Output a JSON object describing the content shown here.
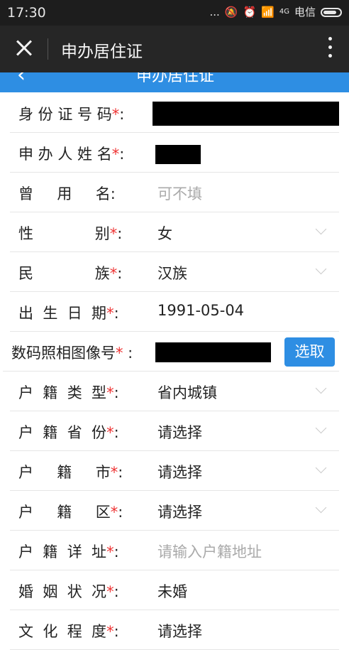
{
  "status_bar": {
    "time": "17:30",
    "dots": "...",
    "network": "4G",
    "carrier": "电信"
  },
  "app_bar": {
    "title": "申办居住证"
  },
  "page_header": {
    "title": "申办居住证"
  },
  "form": {
    "rows": [
      {
        "label": "身 份 证 号 码",
        "required": "*",
        "colon": ":",
        "value": ""
      },
      {
        "label": "申 办 人 姓 名",
        "required": "*",
        "colon": ":",
        "value": ""
      },
      {
        "label": "曾     用     名",
        "required": "",
        "colon": ":",
        "value": "",
        "placeholder": "可不填"
      },
      {
        "label": "性             别",
        "required": "*",
        "colon": ":",
        "value": "女"
      },
      {
        "label": "民             族",
        "required": "*",
        "colon": ":",
        "value": "汉族"
      },
      {
        "label": "出  生  日  期",
        "required": "*",
        "colon": ":",
        "value": "1991-05-04"
      },
      {
        "label": "数码照相图像号",
        "required": "*",
        "colon": " :",
        "value": "",
        "button": "选取"
      },
      {
        "label": "户  籍  类  型",
        "required": "*",
        "colon": ":",
        "value": "省内城镇"
      },
      {
        "label": "户  籍  省  份",
        "required": "*",
        "colon": ":",
        "value": "请选择"
      },
      {
        "label": "户     籍     市",
        "required": "*",
        "colon": ":",
        "value": "请选择"
      },
      {
        "label": "户     籍     区",
        "required": "*",
        "colon": ":",
        "value": "请选择"
      },
      {
        "label": "户  籍  详  址",
        "required": "*",
        "colon": ":",
        "value": "",
        "placeholder": "请输入户籍地址"
      },
      {
        "label": "婚  姻  状  况",
        "required": "*",
        "colon": ":",
        "value": "未婚"
      },
      {
        "label": "文  化  程  度",
        "required": "*",
        "colon": ":",
        "value": "请选择"
      }
    ]
  },
  "colors": {
    "accent": "#2e8ee3",
    "required": "#e33333",
    "app_bar": "#262626"
  }
}
